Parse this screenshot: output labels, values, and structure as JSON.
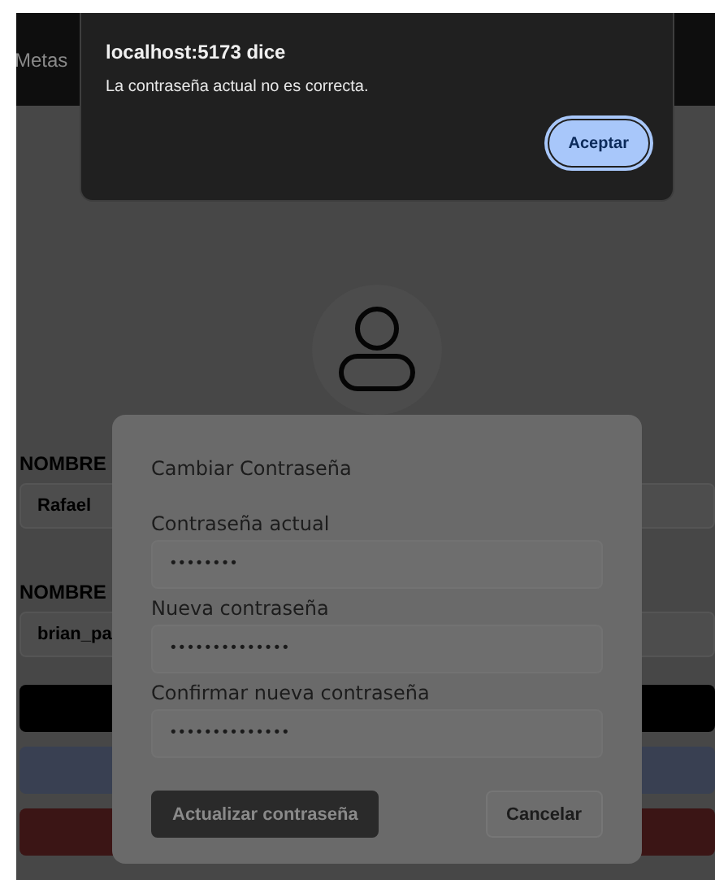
{
  "nav": {
    "items": [
      "Metas"
    ]
  },
  "profile": {
    "fields": [
      {
        "label": "NOMBRE",
        "value": "Rafael"
      },
      {
        "label": "NOMBRE",
        "value": "brian_pa"
      }
    ],
    "action_buttons": [
      {
        "color": "#000000"
      },
      {
        "color": "#394052"
      },
      {
        "color": "#3b1515"
      }
    ]
  },
  "password_dialog": {
    "title": "Cambiar Contraseña",
    "fields": [
      {
        "label": "Contraseña actual",
        "value": "••••••••"
      },
      {
        "label": "Nueva contraseña",
        "value": "••••••••••••••"
      },
      {
        "label": "Confirmar nueva contraseña",
        "value": "••••••••••••••"
      }
    ],
    "buttons": [
      {
        "label": "Actualizar contraseña",
        "kind": "primary"
      },
      {
        "label": "Cancelar",
        "kind": "secondary"
      }
    ]
  },
  "alert": {
    "title": "localhost:5173 dice",
    "message": "La contraseña actual no es correcta.",
    "button": "Aceptar"
  }
}
